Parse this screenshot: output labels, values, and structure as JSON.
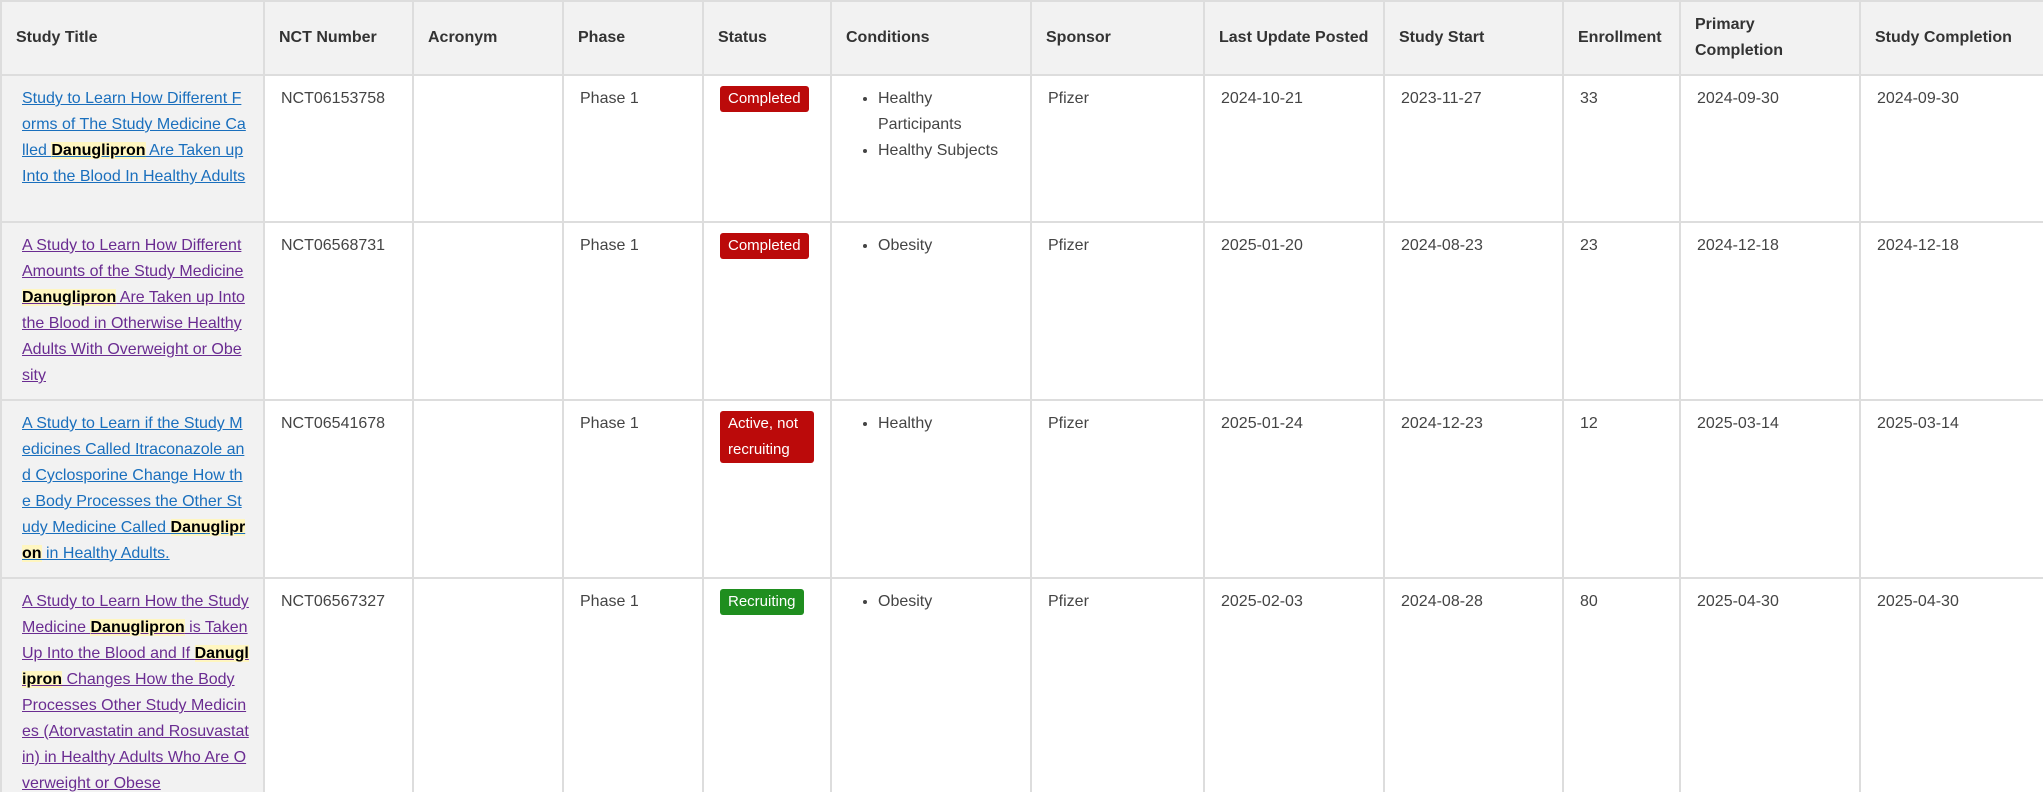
{
  "colors": {
    "header_bg": "#f2f2f2",
    "border": "#dddddd",
    "link_unvisited": "#1a6fbd",
    "link_visited": "#6a2c91",
    "highlight_bg": "#fff6c0",
    "status_completed": "#bb0a0a",
    "status_active": "#bb0a0a",
    "status_recruiting": "#1f8e1f"
  },
  "table": {
    "headers": {
      "study_title": "Study Title",
      "nct_number": "NCT Number",
      "acronym": "Acronym",
      "phase": "Phase",
      "status": "Status",
      "conditions": "Conditions",
      "sponsor": "Sponsor",
      "last_update": "Last Update Posted",
      "study_start": "Study Start",
      "enrollment": "Enrollment",
      "primary_completion": "Primary Completion",
      "study_completion": "Study Completion"
    },
    "rows": [
      {
        "title_parts": [
          "Study to Learn How Different Forms of The Study Medicine Called ",
          "Danuglipron",
          " Are Taken up Into the Blood In Healthy Adults"
        ],
        "nct": "NCT06153758",
        "acronym": "",
        "phase": "Phase 1",
        "status": "Completed",
        "conditions": [
          "Healthy Participants",
          "Healthy Subjects"
        ],
        "sponsor": "Pfizer",
        "last_update": "2024-10-21",
        "study_start": "2023-11-27",
        "enrollment": "33",
        "primary_completion": "2024-09-30",
        "study_completion": "2024-09-30"
      },
      {
        "title_parts": [
          "A Study to Learn How Different Amounts of the Study Medicine ",
          "Danuglipron",
          " Are Taken up Into the Blood in Otherwise Healthy Adults With Overweight or Obesity"
        ],
        "nct": "NCT06568731",
        "acronym": "",
        "phase": "Phase 1",
        "status": "Completed",
        "conditions": [
          "Obesity"
        ],
        "sponsor": "Pfizer",
        "last_update": "2025-01-20",
        "study_start": "2024-08-23",
        "enrollment": "23",
        "primary_completion": "2024-12-18",
        "study_completion": "2024-12-18"
      },
      {
        "title_parts": [
          "A Study to Learn if the Study Medicines Called Itraconazole and Cyclosporine Change How the Body Processes the Other Study Medicine Called ",
          "Danuglipron",
          " in Healthy Adults."
        ],
        "nct": "NCT06541678",
        "acronym": "",
        "phase": "Phase 1",
        "status": "Active, not recruiting",
        "conditions": [
          "Healthy"
        ],
        "sponsor": "Pfizer",
        "last_update": "2025-01-24",
        "study_start": "2024-12-23",
        "enrollment": "12",
        "primary_completion": "2025-03-14",
        "study_completion": "2025-03-14"
      },
      {
        "title_parts": [
          "A Study to Learn How the Study Medicine ",
          "Danuglipron",
          " is Taken Up Into the Blood and If ",
          "Danuglipron",
          " Changes How the Body Processes Other Study Medicines (Atorvastatin and Rosuvastatin) in Healthy Adults Who Are Overweight or Obese"
        ],
        "nct": "NCT06567327",
        "acronym": "",
        "phase": "Phase 1",
        "status": "Recruiting",
        "conditions": [
          "Obesity"
        ],
        "sponsor": "Pfizer",
        "last_update": "2025-02-03",
        "study_start": "2024-08-28",
        "enrollment": "80",
        "primary_completion": "2025-04-30",
        "study_completion": "2025-04-30"
      }
    ]
  }
}
